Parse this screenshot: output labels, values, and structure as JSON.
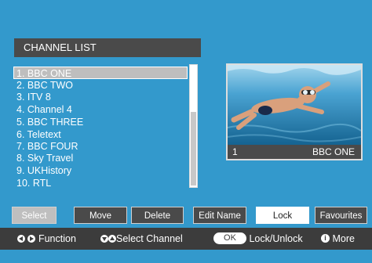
{
  "header": {
    "title": "CHANNEL LIST"
  },
  "channels": [
    {
      "label": "1. BBC ONE",
      "selected": true
    },
    {
      "label": "2. BBC TWO"
    },
    {
      "label": "3. ITV 8"
    },
    {
      "label": "4. Channel 4"
    },
    {
      "label": "5. BBC THREE"
    },
    {
      "label": "6. Teletext"
    },
    {
      "label": "7. BBC FOUR"
    },
    {
      "label": "8. Sky Travel"
    },
    {
      "label": "9. UKHistory"
    },
    {
      "label": "10. RTL"
    }
  ],
  "preview": {
    "number": "1",
    "name": "BBC ONE"
  },
  "buttons": {
    "select": "Select",
    "move": "Move",
    "delete": "Delete",
    "edit_name": "Edit Name",
    "lock": "Lock",
    "favourites": "Favourites"
  },
  "footer": {
    "function": "Function",
    "select_channel": "Select Channel",
    "ok_key": "OK",
    "lock_unlock": "Lock/Unlock",
    "info_key": "i",
    "more": "More"
  },
  "colors": {
    "background": "#3399cc",
    "panel": "#4a4a4a",
    "highlight": "#bebebe"
  }
}
